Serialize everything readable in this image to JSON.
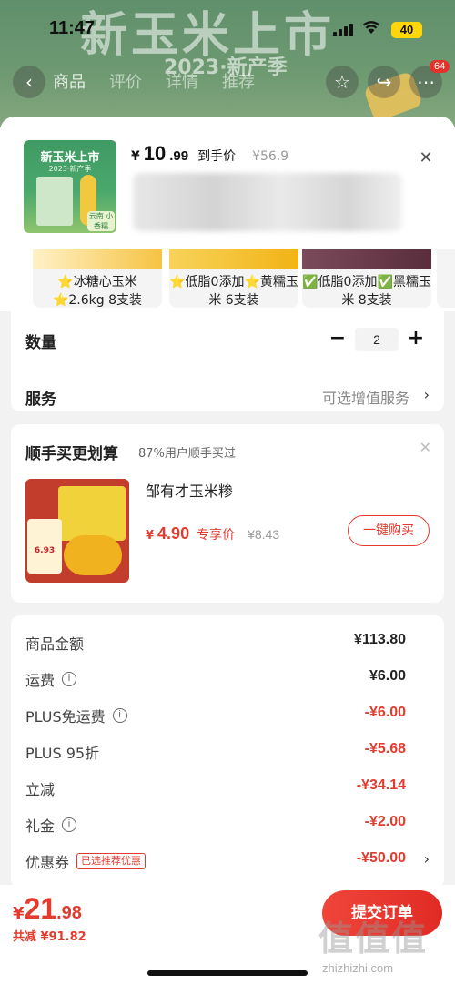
{
  "status_bar": {
    "time": "11:47",
    "battery": "40"
  },
  "banner": {
    "title": "新玉米上市",
    "subtitle": "2023·新产季"
  },
  "nav": {
    "tabs": [
      "商品",
      "评价",
      "详情",
      "推荐"
    ],
    "message_badge": "64"
  },
  "sku": {
    "thumb_title": "新玉米上市",
    "thumb_sub": "2023·新产季",
    "thumb_tag": "云南 小香糯",
    "currency": "¥",
    "price_int": "10",
    "price_dec": ".99",
    "price_tag": "到手价",
    "original_price": "¥56.9"
  },
  "options": [
    {
      "label": "⭐冰糖心玉米⭐2.6kg 8支装",
      "accent": "#f6c343"
    },
    {
      "label": "⭐低脂0添加⭐黄糯玉米 6支装",
      "accent": "#f2b316"
    },
    {
      "label": "✅低脂0添加✅黑糯玉米 8支装",
      "accent": "#5a2d3c"
    }
  ],
  "quantity": {
    "label": "数量",
    "value": "2",
    "minus": "−",
    "plus": "+"
  },
  "service": {
    "label": "服务",
    "value": "可选增值服务"
  },
  "bundle": {
    "title": "顺手买更划算",
    "subtitle": "87%用户顺手买过",
    "product_name": "邹有才玉米糁",
    "currency": "¥",
    "price": "4.90",
    "price_label": "专享价",
    "original_price": "¥8.43",
    "button": "一键购买",
    "img_tag": "6.93"
  },
  "summary": [
    {
      "label": "商品金额",
      "value": "¥113.80",
      "info": false,
      "red": false
    },
    {
      "label": "运费",
      "value": "¥6.00",
      "info": true,
      "red": false
    },
    {
      "label": "PLUS免运费",
      "value": "-¥6.00",
      "info": true,
      "red": true
    },
    {
      "label": "PLUS 95折",
      "value": "-¥5.68",
      "info": false,
      "red": true
    },
    {
      "label": "立减",
      "value": "-¥34.14",
      "info": false,
      "red": true
    },
    {
      "label": "礼金",
      "value": "-¥2.00",
      "info": true,
      "red": true
    },
    {
      "label": "优惠券",
      "value": "-¥50.00",
      "info": false,
      "red": true,
      "badge": "已选推荐优惠",
      "chevron": true
    }
  ],
  "bottom": {
    "currency": "¥",
    "total_int": "21",
    "total_dec": ".98",
    "saved": "共减 ¥91.82",
    "submit": "提交订单",
    "watermark": "值值值",
    "watermark_url": "zhizhizhi.com"
  },
  "colors": {
    "accent_red": "#e33b2e",
    "header_green": "#6f9a72"
  }
}
